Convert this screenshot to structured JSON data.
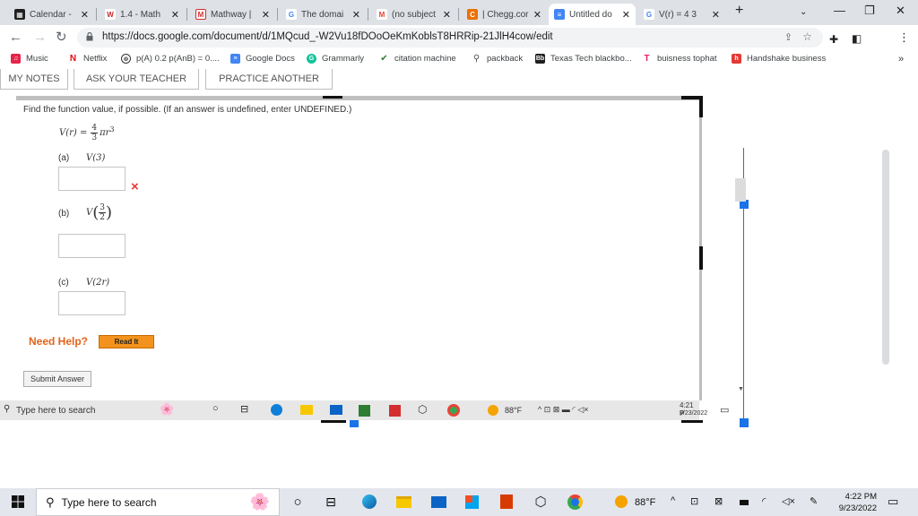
{
  "browser": {
    "tabs": [
      {
        "title": "Calendar -",
        "favicon": "calendar-icon",
        "color": "#1f1f1f"
      },
      {
        "title": "1.4 - Math",
        "favicon": "webassign-icon",
        "color": "#c62828"
      },
      {
        "title": "Mathway |",
        "favicon": "mathway-icon",
        "color": "#d32f2f"
      },
      {
        "title": "The domai",
        "favicon": "google-icon",
        "color": "#4285f4"
      },
      {
        "title": "(no subject",
        "favicon": "gmail-icon",
        "color": "#ea4335"
      },
      {
        "title": "| Chegg.cor",
        "favicon": "chegg-icon",
        "color": "#eb7100"
      },
      {
        "title": "Untitled do",
        "favicon": "docs-icon",
        "color": "#4285f4",
        "active": true
      },
      {
        "title": "V(r) = 4 3",
        "favicon": "google-icon",
        "color": "#4285f4"
      }
    ],
    "new_tab": "+",
    "url": "https://docs.google.com/document/d/1MQcud_-W2Vu18fDOoOeKmKoblsT8HRRip-21JlH4cow/edit",
    "bookmarks": [
      {
        "label": "Music",
        "icon": "music-icon",
        "color": "#e8234a"
      },
      {
        "label": "Netflix",
        "icon": "netflix-icon",
        "color": "#e50914"
      },
      {
        "label": "p(A) 0.2 p(AnB) = 0....",
        "icon": "chatgpt-icon",
        "color": "#333333"
      },
      {
        "label": "Google Docs",
        "icon": "docs-icon",
        "color": "#4285f4"
      },
      {
        "label": "Grammarly",
        "icon": "grammarly-icon",
        "color": "#15c39a"
      },
      {
        "label": "citation machine",
        "icon": "citation-icon",
        "color": "#2e7d32"
      },
      {
        "label": "packback",
        "icon": "packback-icon",
        "color": "#555555"
      },
      {
        "label": "Texas Tech blackbo...",
        "icon": "blackboard-icon",
        "color": "#1f1f1f"
      },
      {
        "label": "buisness tophat",
        "icon": "tophat-icon",
        "color": "#e91e63"
      },
      {
        "label": "Handshake business",
        "icon": "handshake-icon",
        "color": "#e53935"
      }
    ],
    "more_bookmarks": "»"
  },
  "question": {
    "buttons": [
      "MY NOTES",
      "ASK YOUR TEACHER",
      "PRACTICE ANOTHER"
    ],
    "instruction": "Find the function value, if possible. (If an answer is undefined, enter UNDEFINED.)",
    "function_lhs": "V(r) =",
    "frac_num": "4",
    "frac_den": "3",
    "function_rest": "πr",
    "function_exp": "3",
    "parts": [
      {
        "label": "(a)",
        "expr": "V(3)",
        "value": "",
        "marked_wrong": true
      },
      {
        "label": "(b)",
        "expr_prefix": "V",
        "frac_num": "3",
        "frac_den": "2",
        "value": ""
      },
      {
        "label": "(c)",
        "expr": "V(2r)",
        "value": ""
      }
    ],
    "wrong_mark": "×",
    "need_help": "Need Help?",
    "read_it": "Read It",
    "submit": "Submit Answer"
  },
  "inner_taskbar": {
    "search": "Type here to search",
    "temp": "88°F",
    "time": "4:21 P",
    "date": "9/23/2022"
  },
  "taskbar": {
    "search": "Type here to search",
    "temp": "88°F",
    "time": "4:22 PM",
    "date": "9/23/2022"
  }
}
